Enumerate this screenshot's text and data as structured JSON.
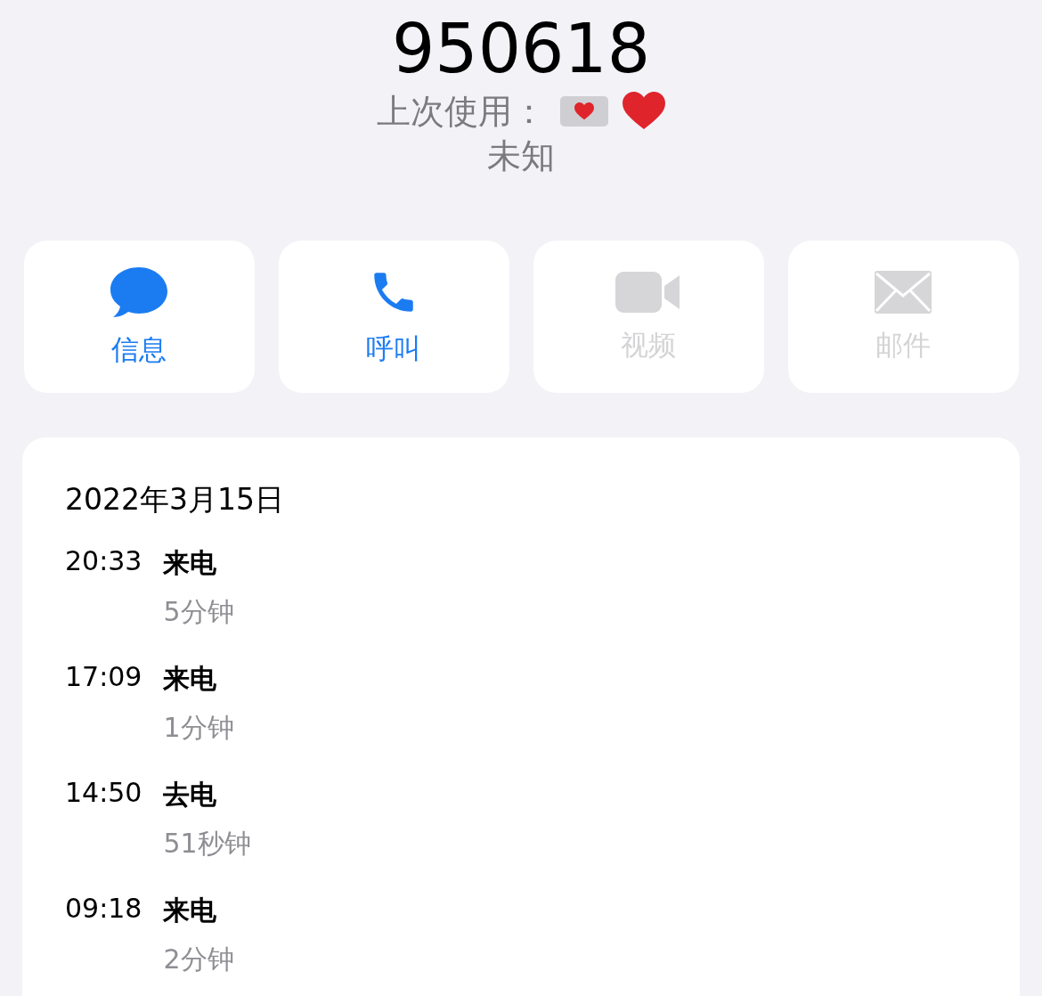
{
  "contact": {
    "name": "950618",
    "last_used_label": "上次使用：",
    "subtitle": "未知"
  },
  "actions": [
    {
      "kind": "message",
      "label": "信息",
      "disabled": false
    },
    {
      "kind": "call",
      "label": "呼叫",
      "disabled": false
    },
    {
      "kind": "video",
      "label": "视频",
      "disabled": true
    },
    {
      "kind": "mail",
      "label": "邮件",
      "disabled": true
    }
  ],
  "call_history": {
    "date": "2022年3月15日",
    "calls": [
      {
        "time": "20:33",
        "type": "来电",
        "duration": "5分钟"
      },
      {
        "time": "17:09",
        "type": "来电",
        "duration": "1分钟"
      },
      {
        "time": "14:50",
        "type": "去电",
        "duration": "51秒钟"
      },
      {
        "time": "09:18",
        "type": "来电",
        "duration": "2分钟"
      }
    ]
  }
}
